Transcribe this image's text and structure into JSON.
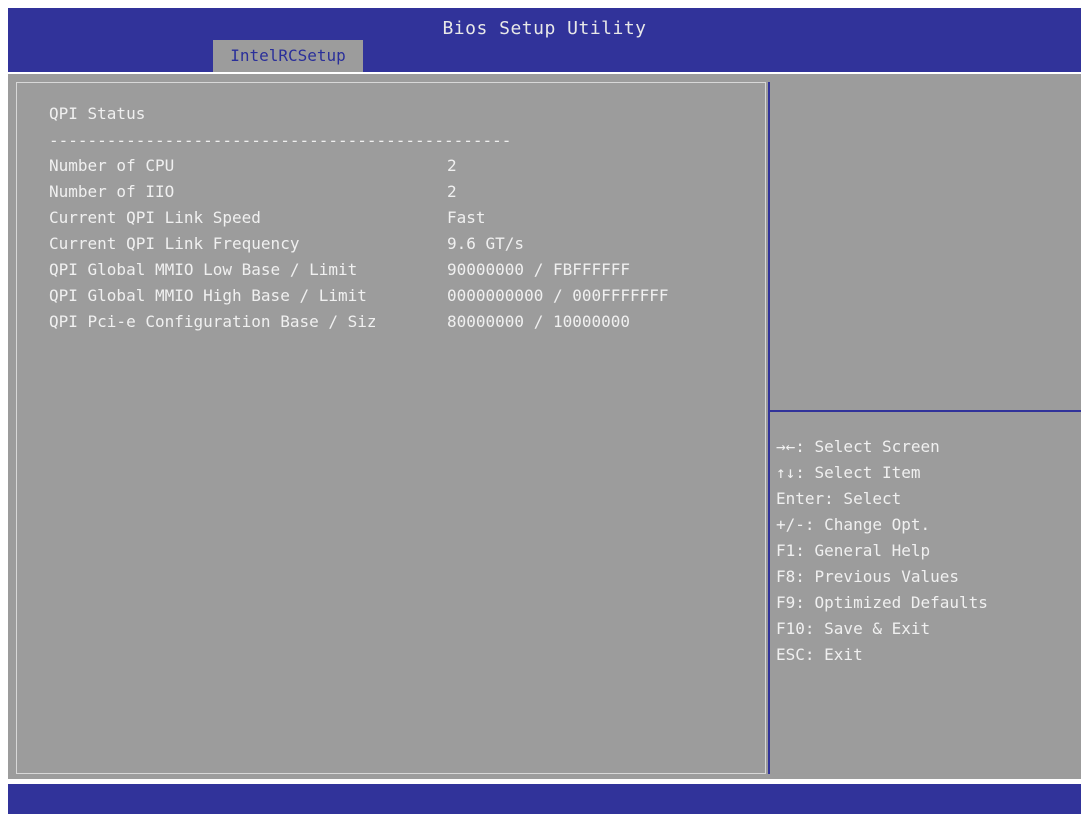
{
  "app": {
    "title": "Bios Setup Utility",
    "active_tab": "IntelRCSetup"
  },
  "page": {
    "heading": "QPI Status",
    "separator": "------------------------------------------------",
    "rows": [
      {
        "label": "Number of CPU",
        "value": "2"
      },
      {
        "label": "Number of IIO",
        "value": "2"
      },
      {
        "label": "Current QPI Link Speed",
        "value": "Fast"
      },
      {
        "label": "Current QPI Link Frequency",
        "value": "9.6 GT/s"
      },
      {
        "label": "QPI Global MMIO Low Base / Limit",
        "value": "90000000 / FBFFFFFF"
      },
      {
        "label": "QPI Global MMIO High Base / Limit",
        "value": "0000000000 / 000FFFFFFF"
      },
      {
        "label": "QPI Pci-e Configuration Base / Siz",
        "value": "80000000 / 10000000"
      }
    ]
  },
  "help": {
    "keys": [
      "→←: Select Screen",
      "↑↓: Select Item",
      "Enter: Select",
      "+/-: Change Opt.",
      "F1: General Help",
      "F8: Previous Values",
      "F9: Optimized Defaults",
      "F10: Save & Exit",
      "ESC: Exit"
    ]
  },
  "colors": {
    "bar": "#31339a",
    "panel": "#9c9c9c",
    "text": "#f0f0f0"
  }
}
